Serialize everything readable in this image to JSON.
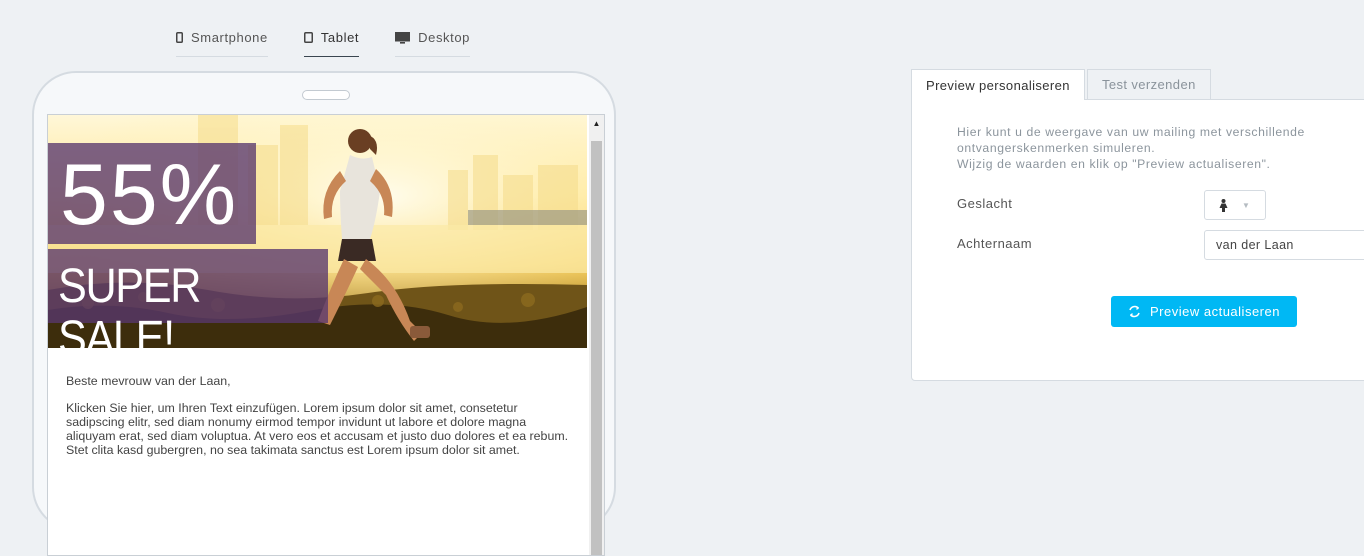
{
  "device_tabs": [
    {
      "label": "Smartphone",
      "icon": "smartphone-icon"
    },
    {
      "label": "Tablet",
      "icon": "tablet-icon",
      "active": true
    },
    {
      "label": "Desktop",
      "icon": "desktop-icon"
    }
  ],
  "email": {
    "banner": {
      "percent": "55%",
      "headline": "SUPER SALE!"
    },
    "greeting": "Beste mevrouw van der Laan,",
    "body_text": "Klicken Sie hier, um Ihren Text einzufügen. Lorem ipsum dolor sit amet, consetetur sadipscing elitr, sed diam nonumy eirmod tempor invidunt ut labore et dolore magna aliquyam erat, sed diam voluptua. At vero eos et accusam et justo duo dolores et ea rebum. Stet clita kasd gubergren, no sea takimata sanctus est Lorem ipsum dolor sit amet."
  },
  "panel": {
    "tabs": [
      {
        "label": "Preview personaliseren",
        "active": true
      },
      {
        "label": "Test verzenden",
        "active": false
      }
    ],
    "description_line1": "Hier kunt u de weergave van uw mailing met verschillende ontvangerskenmerken simuleren.",
    "description_line2": "Wijzig de waarden en klik op \"Preview actualiseren\".",
    "fields": {
      "gender_label": "Geslacht",
      "gender_value_icon": "female-person-icon",
      "lastname_label": "Achternaam",
      "lastname_value": "van der Laan"
    },
    "button_label": "Preview actualiseren"
  },
  "colors": {
    "accent": "#00b8f4",
    "banner_overlay": "#58376e",
    "background": "#eef1f4"
  }
}
